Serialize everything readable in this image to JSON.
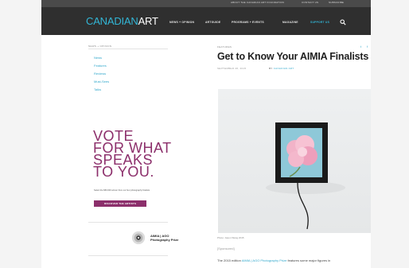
{
  "utility_bar": {
    "links": [
      "ABOUT THE CANADIAN ART FOUNDATION",
      "CONTACT US",
      "SUBSCRIBE"
    ]
  },
  "header": {
    "logo_part1": "CANADIAN",
    "logo_part2": "ART",
    "nav": [
      "NEWS + OPINION",
      "ARTGUIDE",
      "PROGRAMS + EVENTS",
      "MAGAZINE",
      "SUPPORT US"
    ]
  },
  "sidebar": {
    "section_label": "NEWS + OPINION",
    "items": [
      "News",
      "Features",
      "Reviews",
      "Must-Sees",
      "Talks"
    ]
  },
  "promo": {
    "headline": [
      "VOTE",
      "FOR WHAT",
      "SPEAKS",
      "TO YOU."
    ],
    "description": "Select the $50,000 winner from our four photography finalists",
    "button_label": "DISCOVER THE ARTISTS",
    "sponsor_line1": "AIMIA | AGO",
    "sponsor_line2": "Photography Prize"
  },
  "article": {
    "kicker": "FEATURES",
    "title": "Get to Know Your AIMIA Finalists",
    "date": "SEPTEMBER 28, 2015",
    "byline_prefix": "BY",
    "byline_author": "CANADIAN ART",
    "share_icons": [
      "twitter-icon",
      "facebook-icon",
      "email-icon",
      "pinterest-icon"
    ],
    "caption": "Photo: Jason Wang 2015",
    "sponsored": "[Sponsored]",
    "body_prefix": "The 2015 edition",
    "body_link": "AIMIA | AGO Photography Prize",
    "body_suffix": "features some major figures in"
  },
  "colors": {
    "header_bg": "#2f2f2f",
    "accent_blue": "#32b6d6",
    "promo_purple": "#8c2f6b"
  }
}
